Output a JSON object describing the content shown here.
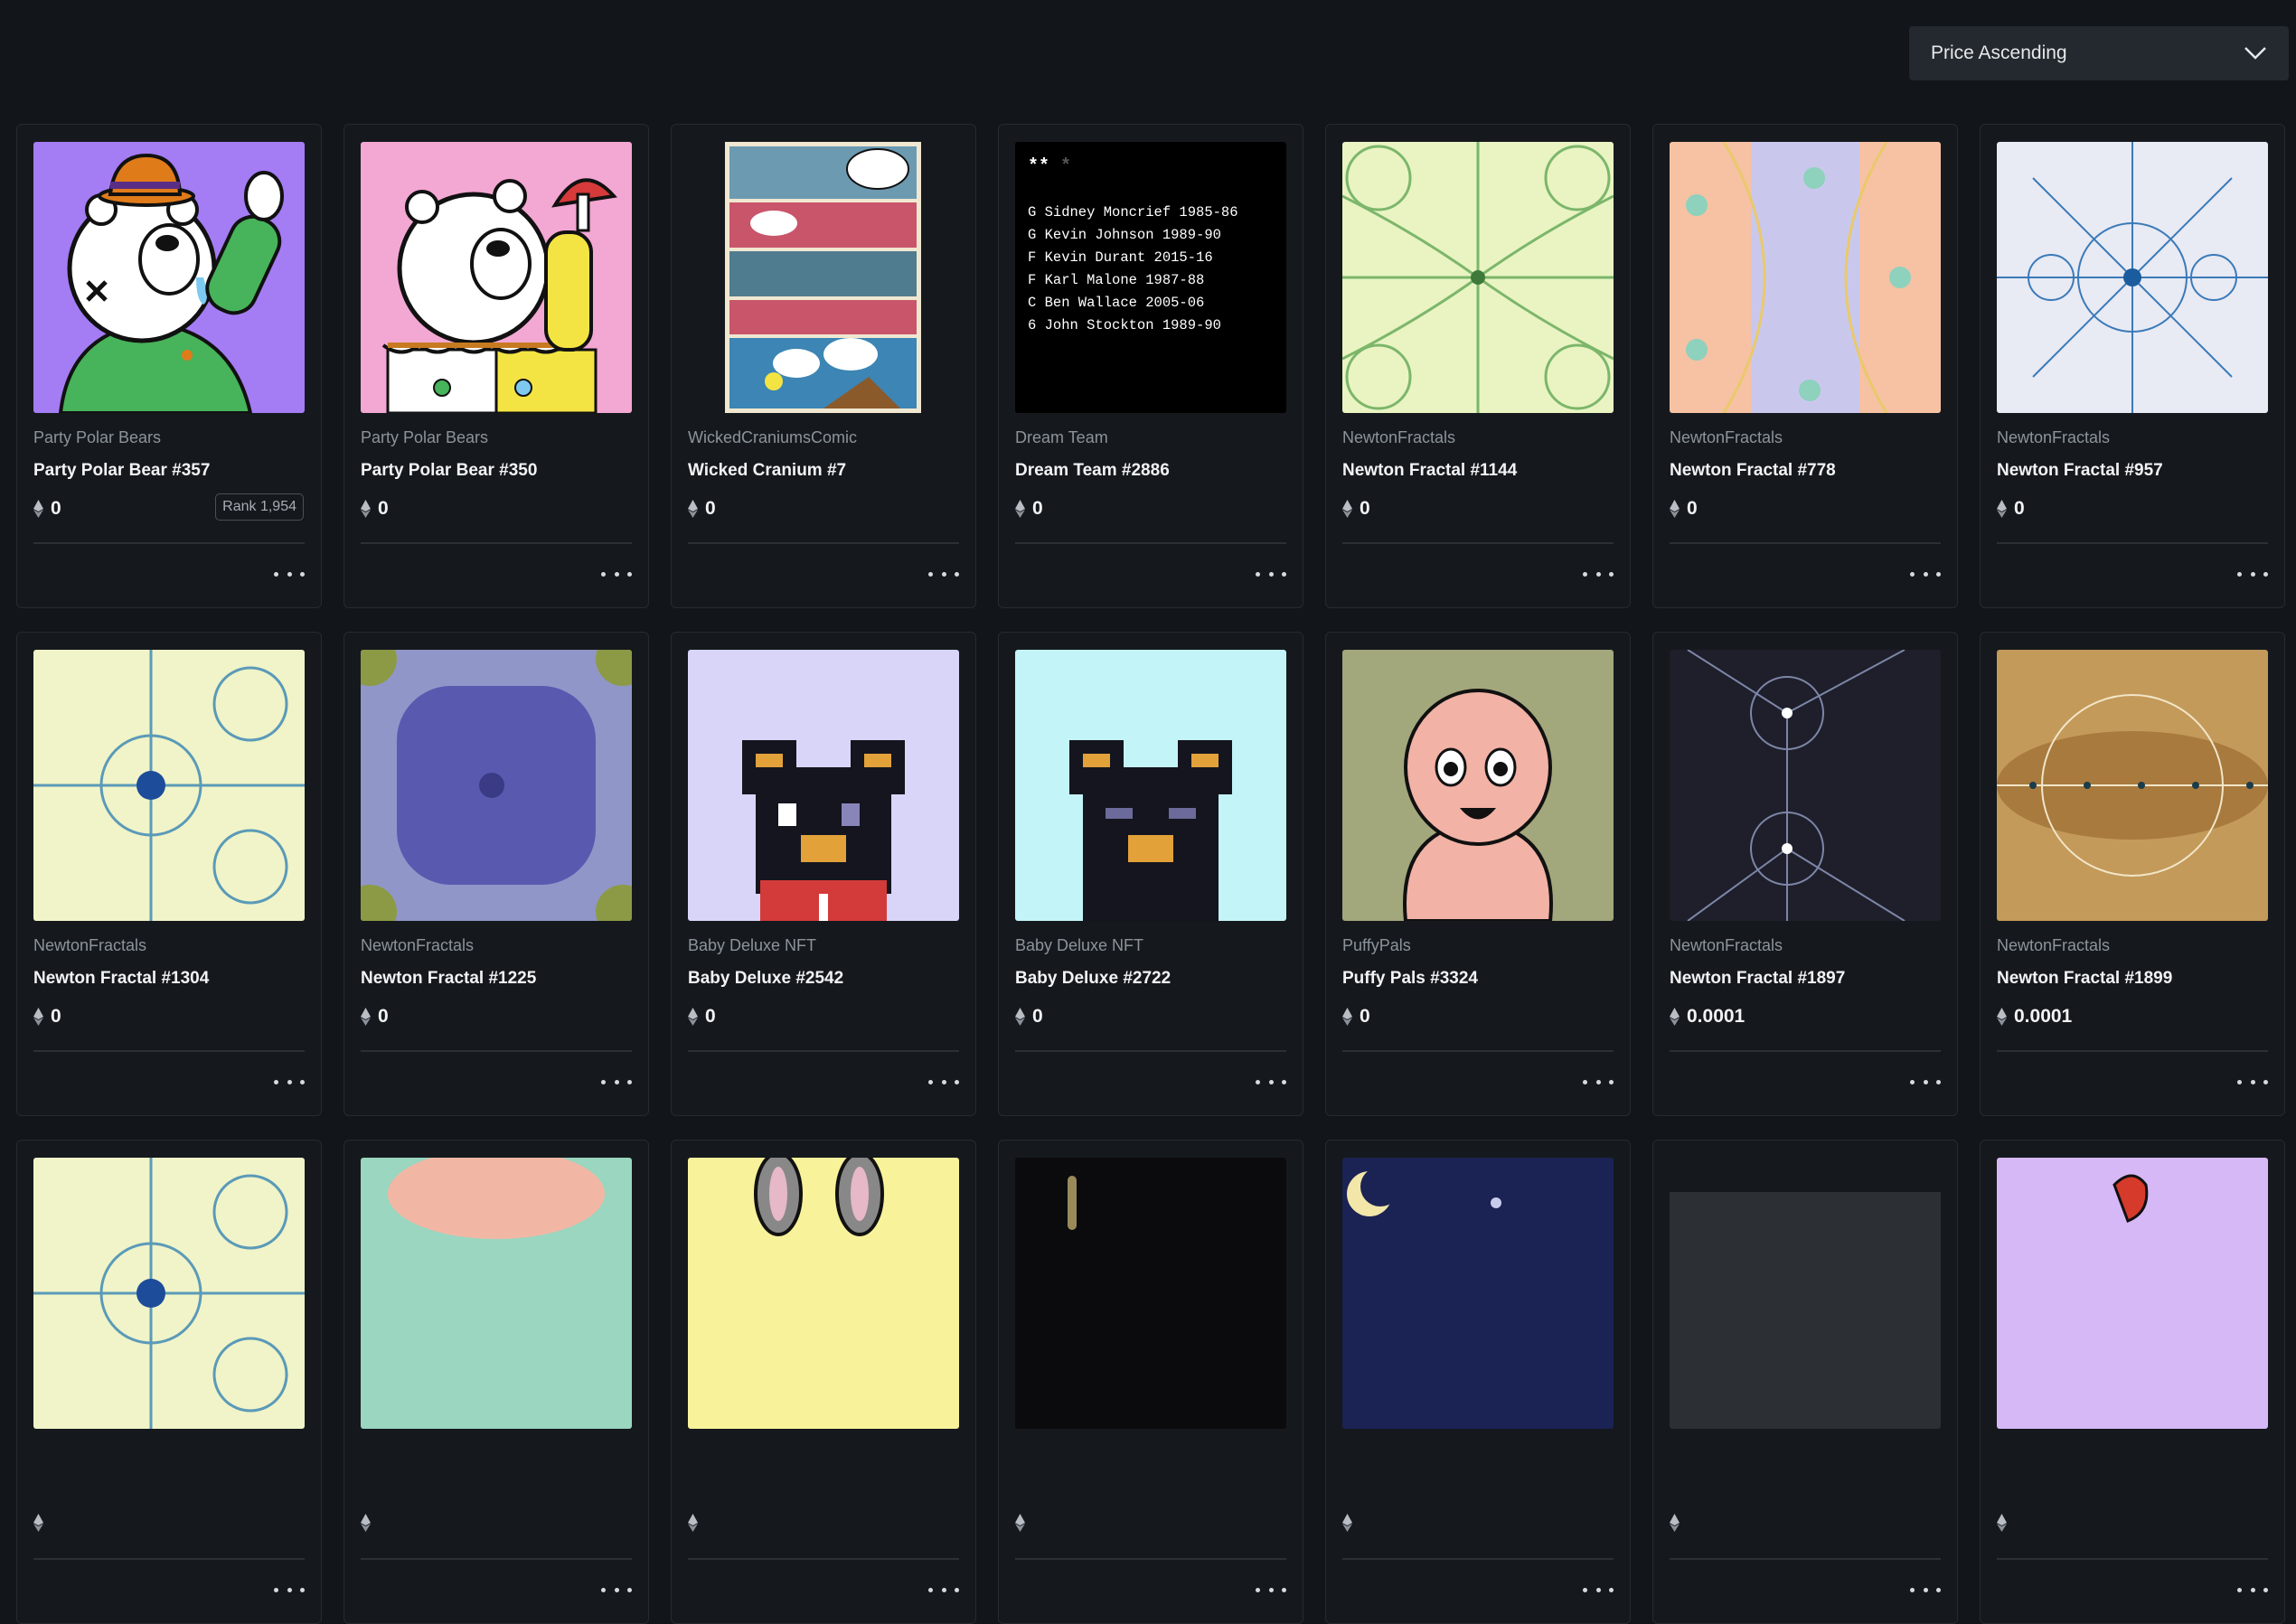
{
  "sort": {
    "selected": "Price Ascending"
  },
  "cards": [
    {
      "collection": "Party Polar Bears",
      "name": "Party Polar Bear #357",
      "price": "0",
      "rank": "Rank 1,954",
      "art": "polar-bear-green"
    },
    {
      "collection": "Party Polar Bears",
      "name": "Party Polar Bear #350",
      "price": "0",
      "art": "polar-bear-clown"
    },
    {
      "collection": "WickedCraniumsComic",
      "name": "Wicked Cranium #7",
      "price": "0",
      "art": "comic-page"
    },
    {
      "collection": "Dream Team",
      "name": "Dream Team #2886",
      "price": "0",
      "art": "dream-team-list",
      "art_text": [
        "G Sidney Moncrief 1985-86",
        "G Kevin Johnson 1989-90",
        "F Kevin Durant 2015-16",
        "F Karl Malone 1987-88",
        "C Ben Wallace 2005-06",
        "6 John Stockton 1989-90"
      ]
    },
    {
      "collection": "NewtonFractals",
      "name": "Newton Fractal #1144",
      "price": "0",
      "art": "fractal-green"
    },
    {
      "collection": "NewtonFractals",
      "name": "Newton Fractal #778",
      "price": "0",
      "art": "fractal-pastel"
    },
    {
      "collection": "NewtonFractals",
      "name": "Newton Fractal #957",
      "price": "0",
      "art": "fractal-blue-white"
    },
    {
      "collection": "NewtonFractals",
      "name": "Newton Fractal #1304",
      "price": "0",
      "art": "fractal-yellow-blue"
    },
    {
      "collection": "NewtonFractals",
      "name": "Newton Fractal #1225",
      "price": "0",
      "art": "fractal-purple"
    },
    {
      "collection": "Baby Deluxe NFT",
      "name": "Baby Deluxe #2542",
      "price": "0",
      "art": "pixel-bear-lavender"
    },
    {
      "collection": "Baby Deluxe NFT",
      "name": "Baby Deluxe #2722",
      "price": "0",
      "art": "pixel-bear-cyan"
    },
    {
      "collection": "PuffyPals",
      "name": "Puffy Pals #3324",
      "price": "0",
      "art": "puffy-pink"
    },
    {
      "collection": "NewtonFractals",
      "name": "Newton Fractal #1897",
      "price": "0.0001",
      "art": "fractal-dark"
    },
    {
      "collection": "NewtonFractals",
      "name": "Newton Fractal #1899",
      "price": "0.0001",
      "art": "fractal-gold"
    },
    {
      "collection": "",
      "name": "",
      "price": "",
      "art": "fractal-yellow-blue"
    },
    {
      "collection": "",
      "name": "",
      "price": "",
      "art": "fractal-mint"
    },
    {
      "collection": "",
      "name": "",
      "price": "",
      "art": "bunny-yellow"
    },
    {
      "collection": "",
      "name": "",
      "price": "",
      "art": "dark-stick"
    },
    {
      "collection": "",
      "name": "",
      "price": "",
      "art": "night-moon"
    },
    {
      "collection": "",
      "name": "",
      "price": "",
      "art": "dark-gray"
    },
    {
      "collection": "",
      "name": "",
      "price": "",
      "art": "lavender-red"
    }
  ],
  "icons": {
    "eth": "ethereum-icon",
    "more": "more-horizontal-icon",
    "chevron": "chevron-down-icon"
  }
}
